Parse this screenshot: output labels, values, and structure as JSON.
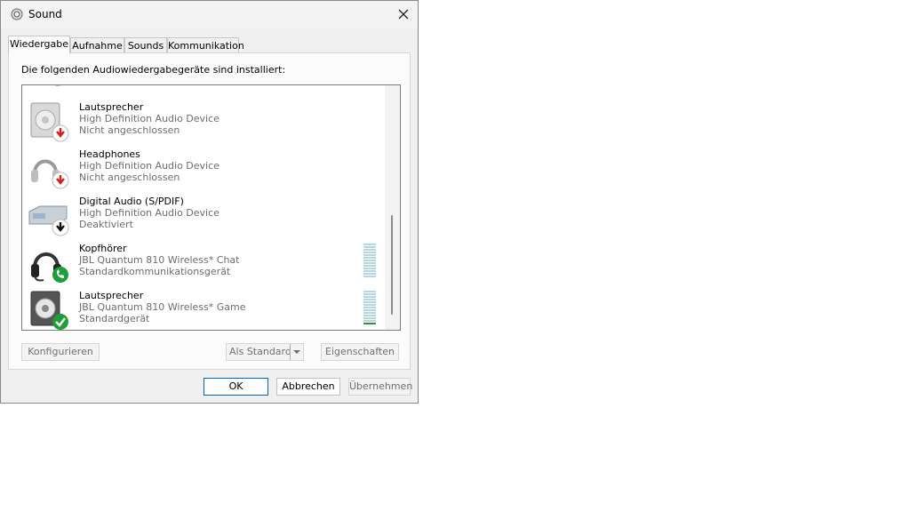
{
  "window": {
    "title": "Sound",
    "app_icon": "speaker-gear-icon",
    "close_icon": "close-icon"
  },
  "tabs": [
    {
      "label": "Wiedergabe",
      "active": true
    },
    {
      "label": "Aufnahme",
      "active": false
    },
    {
      "label": "Sounds",
      "active": false
    },
    {
      "label": "Kommunikation",
      "active": false
    }
  ],
  "panel": {
    "intro": "Die folgenden Audiowiedergabegeräte sind installiert:"
  },
  "devices": [
    {
      "name": "Lautsprecher",
      "driver": "High Definition Audio Device",
      "status": "Nicht angeschlossen",
      "icon": "speaker-icon",
      "badge": "red-down-arrow-icon"
    },
    {
      "name": "Headphones",
      "driver": "High Definition Audio Device",
      "status": "Nicht angeschlossen",
      "icon": "headphones-icon",
      "badge": "red-down-arrow-icon"
    },
    {
      "name": "Digital Audio (S/PDIF)",
      "driver": "High Definition Audio Device",
      "status": "Deaktiviert",
      "icon": "spdif-device-icon",
      "badge": "black-down-arrow-icon"
    },
    {
      "name": "Kopfhörer",
      "driver": "JBL Quantum 810 Wireless* Chat",
      "status": "Standardkommunikationsgerät",
      "icon": "headset-icon",
      "badge": "green-phone-icon",
      "level": 0
    },
    {
      "name": "Lautsprecher",
      "driver": "JBL Quantum 810 Wireless* Game",
      "status": "Standardgerät",
      "icon": "speaker-icon",
      "badge": "green-check-icon",
      "level": 0.08
    }
  ],
  "buttons": {
    "configure": "Konfigurieren",
    "set_default": "Als Standard",
    "properties": "Eigenschaften",
    "ok": "OK",
    "cancel": "Abbrechen",
    "apply": "Übernehmen"
  },
  "colors": {
    "accent": "#0067c0",
    "meter_on": "#2a9a3a",
    "meter_off": "#b7d7e0"
  }
}
